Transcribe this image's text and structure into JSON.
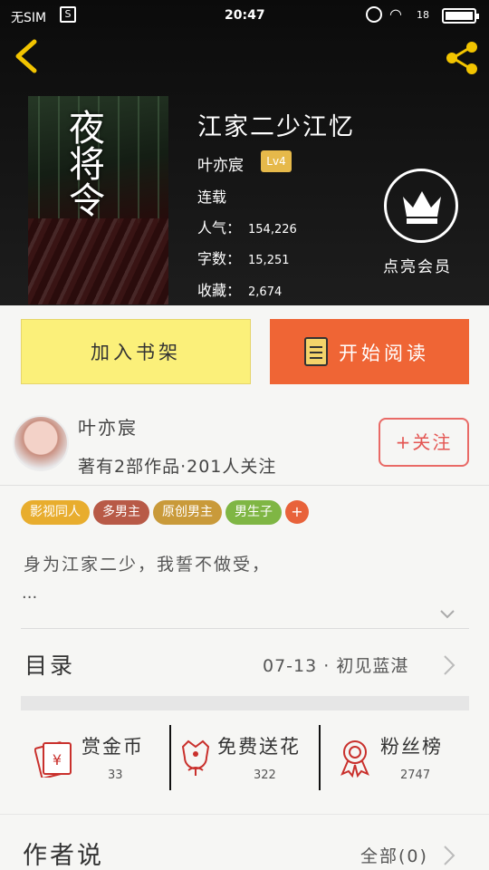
{
  "status_bar": {
    "carrier": "无SIM",
    "time": "20:47",
    "battery_pct": "18"
  },
  "book": {
    "title": "江家二少江忆",
    "author": "叶亦宸",
    "level": "Lv4",
    "status": "连载",
    "popularity_label": "人气：",
    "popularity": "154,226",
    "words_label": "字数：",
    "words": "15,251",
    "favorites_label": "收藏：",
    "favorites": "2,674",
    "cover_title": "夜将令"
  },
  "vip": {
    "label": "点亮会员"
  },
  "actions": {
    "add_shelf": "加入书架",
    "start_read": "开始阅读"
  },
  "author_card": {
    "name": "叶亦宸",
    "summary": "著有2部作品·201人关注",
    "follow": "+关注"
  },
  "tags": [
    {
      "label": "影视同人",
      "color": "#e8ad2e"
    },
    {
      "label": "多男主",
      "color": "#b85a47"
    },
    {
      "label": "原创男主",
      "color": "#c99a3a"
    },
    {
      "label": "男生子",
      "color": "#7fb644"
    }
  ],
  "tag_more": "+",
  "tag_more_color": "#e8623a",
  "description": {
    "text": "身为江家二少，我誓不做受，",
    "ellipsis": "..."
  },
  "toc": {
    "label": "目录",
    "latest": "07-13 · 初见蓝湛"
  },
  "stats": [
    {
      "label": "赏金币",
      "value": "33",
      "icon": "red-envelope-icon"
    },
    {
      "label": "免费送花",
      "value": "322",
      "icon": "flower-icon"
    },
    {
      "label": "粉丝榜",
      "value": "2747",
      "icon": "ribbon-medal-icon"
    }
  ],
  "author_say": {
    "label": "作者说",
    "count": "全部(0)"
  }
}
